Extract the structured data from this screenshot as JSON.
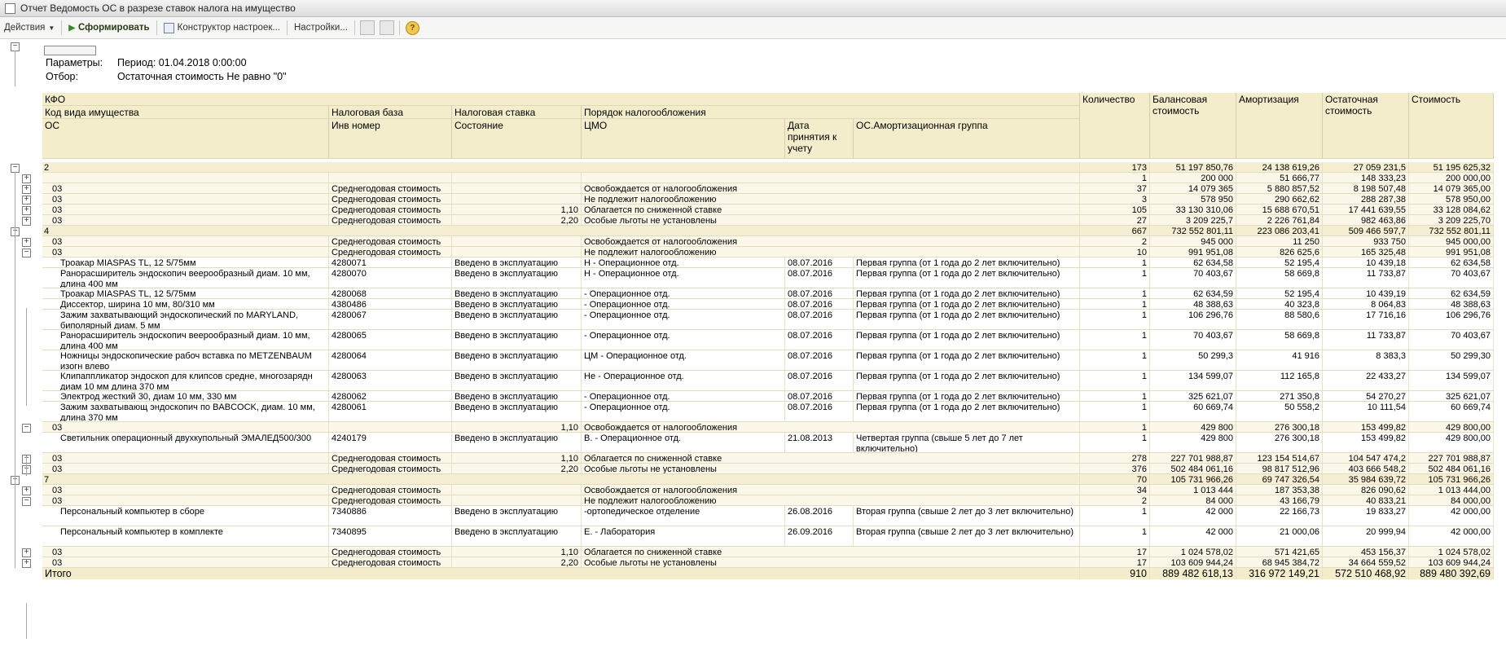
{
  "window": {
    "title": "Отчет  Ведомость ОС в разрезе ставок налога на имущество"
  },
  "toolbar": {
    "actions_label": "Действия",
    "generate_label": "Сформировать",
    "constructor_label": "Конструктор настроек...",
    "settings_label": "Настройки...",
    "help_glyph": "?"
  },
  "params": {
    "label_params": "Параметры:",
    "period": "Период: 01.04.2018 0:00:00",
    "label_filter": "Отбор:",
    "filter": "Остаточная стоимость Не равно \"0\""
  },
  "headers": {
    "kfo": "КФО",
    "code": "Код вида имущества",
    "os": "ОС",
    "tax_base": "Налоговая база",
    "inv": "Инв номер",
    "rate": "Налоговая ставка",
    "state": "Состояние",
    "order": "Порядок налогообложения",
    "cmo": "ЦМО",
    "date": "Дата принятия к учету",
    "amort_group": "ОС.Амортизационная группа",
    "qty": "Количество",
    "balance": "Балансовая стоимость",
    "amort": "Амортизация",
    "residual": "Остаточная стоимость",
    "cost": "Стоимость"
  },
  "rows": [
    {
      "t": "g1",
      "col0": "2",
      "qty": "173",
      "bal": "51 197 850,76",
      "am": "24 138 619,26",
      "res": "27 059 231,5",
      "cost": "51 195 625,32"
    },
    {
      "t": "g2",
      "col0": "",
      "base": "",
      "rate": "",
      "order": "",
      "qty": "1",
      "bal": "200 000",
      "am": "51 666,77",
      "res": "148 333,23",
      "cost": "200 000,00"
    },
    {
      "t": "g2",
      "col0": "03",
      "base": "Среднегодовая стоимость",
      "rate": "",
      "order": "Освобождается от налогообложения",
      "qty": "37",
      "bal": "14 079 365",
      "am": "5 880 857,52",
      "res": "8 198 507,48",
      "cost": "14 079 365,00"
    },
    {
      "t": "g2",
      "col0": "03",
      "base": "Среднегодовая стоимость",
      "rate": "",
      "order": "Не подлежит налогообложению",
      "qty": "3",
      "bal": "578 950",
      "am": "290 662,62",
      "res": "288 287,38",
      "cost": "578 950,00"
    },
    {
      "t": "g2",
      "col0": "03",
      "base": "Среднегодовая стоимость",
      "rate": "1,10",
      "order": "Облагается по сниженной ставке",
      "qty": "105",
      "bal": "33 130 310,06",
      "am": "15 688 670,51",
      "res": "17 441 639,55",
      "cost": "33 128 084,62"
    },
    {
      "t": "g2",
      "col0": "03",
      "base": "Среднегодовая стоимость",
      "rate": "2,20",
      "order": "Особые льготы не установлены",
      "qty": "27",
      "bal": "3 209 225,7",
      "am": "2 226 761,84",
      "res": "982 463,86",
      "cost": "3 209 225,70"
    },
    {
      "t": "g1",
      "col0": "4",
      "qty": "667",
      "bal": "732 552 801,11",
      "am": "223 086 203,41",
      "res": "509 466 597,7",
      "cost": "732 552 801,11"
    },
    {
      "t": "g2",
      "col0": "03",
      "base": "Среднегодовая стоимость",
      "rate": "",
      "order": "Освобождается от налогообложения",
      "qty": "2",
      "bal": "945 000",
      "am": "11 250",
      "res": "933 750",
      "cost": "945 000,00"
    },
    {
      "t": "g2",
      "col0": "03",
      "base": "Среднегодовая стоимость",
      "rate": "",
      "order": "Не подлежит налогообложению",
      "qty": "10",
      "bal": "991 951,08",
      "am": "826 625,6",
      "res": "165 325,48",
      "cost": "991 951,08"
    },
    {
      "t": "det",
      "col0": "Троакар MIASPAS TL, 12 5/75мм",
      "base": "4280071",
      "rate": "Введено в эксплуатацию",
      "order": "Н        - Операционное отд.",
      "date": "08.07.2016",
      "grp": "Первая группа (от 1 года до 2 лет включительно)",
      "qty": "1",
      "bal": "62 634,58",
      "am": "52 195,4",
      "res": "10 439,18",
      "cost": "62 634,58"
    },
    {
      "t": "det",
      "col0": "Ранорасширитель эндоскопич веерообразный диам. 10 мм, длина 400 мм",
      "base": "4280070",
      "rate": "Введено в эксплуатацию",
      "order": "Н        - Операционное отд.",
      "date": "08.07.2016",
      "grp": "Первая группа (от 1 года до 2 лет включительно)",
      "qty": "1",
      "bal": "70 403,67",
      "am": "58 669,8",
      "res": "11 733,87",
      "cost": "70 403,67"
    },
    {
      "t": "det",
      "col0": "Троакар MIASPAS TL, 12 5/75мм",
      "base": "4280068",
      "rate": "Введено в эксплуатацию",
      "order": "         - Операционное отд.",
      "date": "08.07.2016",
      "grp": "Первая группа (от 1 года до 2 лет включительно)",
      "qty": "1",
      "bal": "62 634,59",
      "am": "52 195,4",
      "res": "10 439,19",
      "cost": "62 634,59"
    },
    {
      "t": "det",
      "col0": "Диссектор, ширина 10 мм, 80/310 мм",
      "base": "4380486",
      "rate": "Введено в эксплуатацию",
      "order": "         - Операционное отд.",
      "date": "08.07.2016",
      "grp": "Первая группа (от 1 года до 2 лет включительно)",
      "qty": "1",
      "bal": "48 388,63",
      "am": "40 323,8",
      "res": "8 064,83",
      "cost": "48 388,63"
    },
    {
      "t": "det",
      "col0": "Зажим захватывающий эндоскопический по MARYLAND, биполярный диам. 5 мм",
      "base": "4280067",
      "rate": "Введено в эксплуатацию",
      "order": "         - Операционное отд.",
      "date": "08.07.2016",
      "grp": "Первая группа (от 1 года до 2 лет включительно)",
      "qty": "1",
      "bal": "106 296,76",
      "am": "88 580,6",
      "res": "17 716,16",
      "cost": "106 296,76"
    },
    {
      "t": "det",
      "col0": "Ранорасширитель эндоскопич веерообразный диам. 10 мм, длина 400 мм",
      "base": "4280065",
      "rate": "Введено в эксплуатацию",
      "order": "         - Операционное отд.",
      "date": "08.07.2016",
      "grp": "Первая группа (от 1 года до 2 лет включительно)",
      "qty": "1",
      "bal": "70 403,67",
      "am": "58 669,8",
      "res": "11 733,87",
      "cost": "70 403,67"
    },
    {
      "t": "det",
      "col0": "Ножницы эндоскопические рабоч вставка по METZENBAUM изогн влево",
      "base": "4280064",
      "rate": "Введено в эксплуатацию",
      "order": "ЦМ       - Операционное отд.",
      "date": "08.07.2016",
      "grp": "Первая группа (от 1 года до 2 лет включительно)",
      "qty": "1",
      "bal": "50 299,3",
      "am": "41 916",
      "res": "8 383,3",
      "cost": "50 299,30"
    },
    {
      "t": "det",
      "col0": "Клипаппликатор эндоскоп для клипсов средне, многозарядн диам 10 мм длина 370 мм",
      "base": "4280063",
      "rate": "Введено в эксплуатацию",
      "order": "Не       - Операционное отд.",
      "date": "08.07.2016",
      "grp": "Первая группа (от 1 года до 2 лет включительно)",
      "qty": "1",
      "bal": "134 599,07",
      "am": "112 165,8",
      "res": "22 433,27",
      "cost": "134 599,07"
    },
    {
      "t": "det",
      "col0": "Электрод жесткий 30, диам 10 мм, 330 мм",
      "base": "4280062",
      "rate": "Введено в эксплуатацию",
      "order": "         - Операционное отд.",
      "date": "08.07.2016",
      "grp": "Первая группа (от 1 года до 2 лет включительно)",
      "qty": "1",
      "bal": "325 621,07",
      "am": "271 350,8",
      "res": "54 270,27",
      "cost": "325 621,07"
    },
    {
      "t": "det",
      "col0": "Зажим захватывающ эндоскопич по BABCOCK, диам. 10 мм, длина 370 мм",
      "base": "4280061",
      "rate": "Введено в эксплуатацию",
      "order": "         - Операционное отд.",
      "date": "08.07.2016",
      "grp": "Первая группа (от 1 года до 2 лет включительно)",
      "qty": "1",
      "bal": "60 669,74",
      "am": "50 558,2",
      "res": "10 111,54",
      "cost": "60 669,74"
    },
    {
      "t": "g2",
      "col0": "03",
      "base": "",
      "rate": "1,10",
      "order": "Освобождается от налогообложения",
      "qty": "1",
      "bal": "429 800",
      "am": "276 300,18",
      "res": "153 499,82",
      "cost": "429 800,00"
    },
    {
      "t": "det",
      "col0": "Светильник операционный двухкупольный ЭМАЛЕД500/300",
      "base": "4240179",
      "rate": "Введено в эксплуатацию",
      "order": "         В. - Операционное отд.",
      "date": "21.08.2013",
      "grp": "Четвертая группа (свыше 5 лет до 7 лет включительно)",
      "qty": "1",
      "bal": "429 800",
      "am": "276 300,18",
      "res": "153 499,82",
      "cost": "429 800,00"
    },
    {
      "t": "g2",
      "col0": "03",
      "base": "Среднегодовая стоимость",
      "rate": "1,10",
      "order": "Облагается по сниженной ставке",
      "qty": "278",
      "bal": "227 701 988,87",
      "am": "123 154 514,67",
      "res": "104 547 474,2",
      "cost": "227 701 988,87"
    },
    {
      "t": "g2",
      "col0": "03",
      "base": "Среднегодовая стоимость",
      "rate": "2,20",
      "order": "Особые льготы не установлены",
      "qty": "376",
      "bal": "502 484 061,16",
      "am": "98 817 512,96",
      "res": "403 666 548,2",
      "cost": "502 484 061,16"
    },
    {
      "t": "g1",
      "col0": "7",
      "qty": "70",
      "bal": "105 731 966,26",
      "am": "69 747 326,54",
      "res": "35 984 639,72",
      "cost": "105 731 966,26"
    },
    {
      "t": "g2",
      "col0": "03",
      "base": "Среднегодовая стоимость",
      "rate": "",
      "order": "Освобождается от налогообложения",
      "qty": "34",
      "bal": "1 013 444",
      "am": "187 353,38",
      "res": "826 090,62",
      "cost": "1 013 444,00"
    },
    {
      "t": "g2",
      "col0": "03",
      "base": "Среднегодовая стоимость",
      "rate": "",
      "order": "Не подлежит налогообложению",
      "qty": "2",
      "bal": "84 000",
      "am": "43 166,79",
      "res": "40 833,21",
      "cost": "84 000,00"
    },
    {
      "t": "det",
      "col0": "Персональный компьютер в сборе",
      "base": "7340886",
      "rate": "Введено в эксплуатацию",
      "order": "         -ортопедическое отделение",
      "date": "26.08.2016",
      "grp": "Вторая группа (свыше 2 лет до 3 лет включительно)",
      "qty": "1",
      "bal": "42 000",
      "am": "22 166,73",
      "res": "19 833,27",
      "cost": "42 000,00"
    },
    {
      "t": "det",
      "col0": "Персональный компьютер в комплекте",
      "base": "7340895",
      "rate": "Введено в эксплуатацию",
      "order": "         Е. - Лаборатория",
      "date": "26.09.2016",
      "grp": "Вторая группа (свыше 2 лет до 3 лет включительно)",
      "qty": "1",
      "bal": "42 000",
      "am": "21 000,06",
      "res": "20 999,94",
      "cost": "42 000,00"
    },
    {
      "t": "g2",
      "col0": "03",
      "base": "Среднегодовая стоимость",
      "rate": "1,10",
      "order": "Облагается по сниженной ставке",
      "qty": "17",
      "bal": "1 024 578,02",
      "am": "571 421,65",
      "res": "453 156,37",
      "cost": "1 024 578,02"
    },
    {
      "t": "g2",
      "col0": "03",
      "base": "Среднегодовая стоимость",
      "rate": "2,20",
      "order": "Особые льготы не установлены",
      "qty": "17",
      "bal": "103 609 944,24",
      "am": "68 945 384,72",
      "res": "34 664 559,52",
      "cost": "103 609 944,24"
    }
  ],
  "total": {
    "label": "Итого",
    "qty": "910",
    "bal": "889 482 618,13",
    "am": "316 972 149,21",
    "res": "572 510 468,92",
    "cost": "889 480 392,69"
  }
}
